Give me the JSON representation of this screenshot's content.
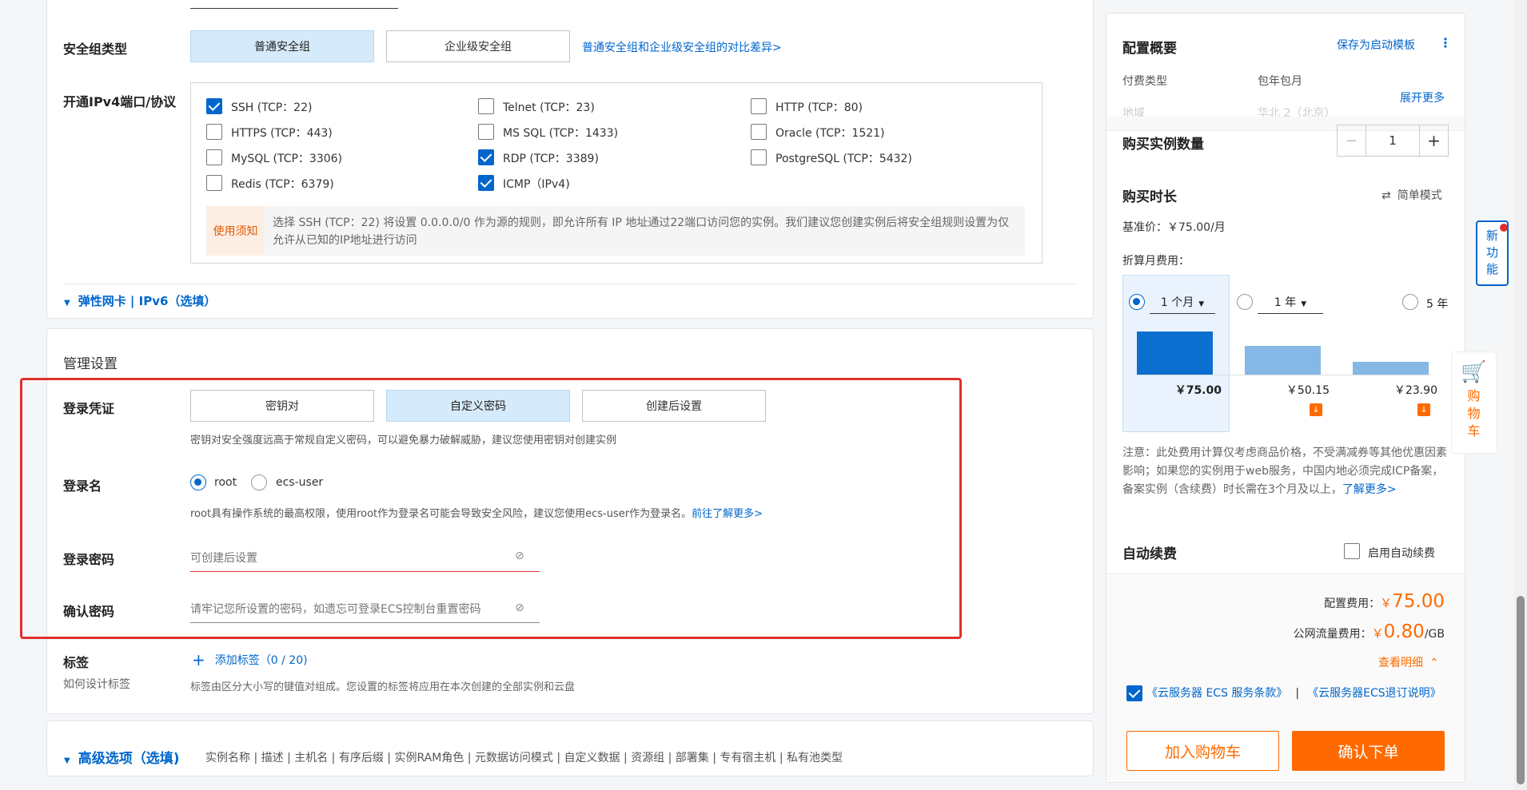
{
  "security_group": {
    "label": "安全组类型",
    "options": [
      "普通安全组",
      "企业级安全组"
    ],
    "compare_link": "普通安全组和企业级安全组的对比差异>"
  },
  "ports": {
    "label": "开通IPv4端口/协议",
    "items": [
      {
        "text": "SSH (TCP：22)",
        "checked": true
      },
      {
        "text": "Telnet (TCP：23)",
        "checked": false
      },
      {
        "text": "HTTP (TCP：80)",
        "checked": false
      },
      {
        "text": "HTTPS (TCP：443)",
        "checked": false
      },
      {
        "text": "MS SQL (TCP：1433)",
        "checked": false
      },
      {
        "text": "Oracle (TCP：1521)",
        "checked": false
      },
      {
        "text": "MySQL (TCP：3306)",
        "checked": false
      },
      {
        "text": "RDP (TCP：3389)",
        "checked": true
      },
      {
        "text": "PostgreSQL (TCP：5432)",
        "checked": false
      },
      {
        "text": "Redis (TCP：6379)",
        "checked": false
      },
      {
        "text": "ICMP（IPv4)",
        "checked": true
      }
    ],
    "notice_tag": "使用须知",
    "notice_text": "选择 SSH (TCP：22) 将设置 0.0.0.0/0 作为源的规则，即允许所有 IP 地址通过22端口访问您的实例。我们建议您创建实例后将安全组规则设置为仅允许从已知的IP地址进行访问"
  },
  "eni": {
    "label": "弹性网卡 | IPv6（选填）"
  },
  "mgmt": {
    "title": "管理设置",
    "credential": {
      "label": "登录凭证",
      "options": [
        "密钥对",
        "自定义密码",
        "创建后设置"
      ],
      "selected": 1,
      "hint": "密钥对安全强度远高于常规自定义密码，可以避免暴力破解威胁，建议您使用密钥对创建实例"
    },
    "login_name": {
      "label": "登录名",
      "options": [
        "root",
        "ecs-user"
      ],
      "hint": "root具有操作系统的最高权限，使用root作为登录名可能会导致安全风险，建议您使用ecs-user作为登录名。",
      "hint_link": "前往了解更多>"
    },
    "password": {
      "label": "登录密码",
      "placeholder": "可创建后设置"
    },
    "confirm": {
      "label": "确认密码",
      "placeholder": "请牢记您所设置的密码，如遗忘可登录ECS控制台重置密码"
    },
    "tags": {
      "label": "标签",
      "sub": "如何设计标签",
      "add": "添加标签（0 / 20)",
      "hint": "标签由区分大小写的键值对组成。您设置的标签将应用在本次创建的全部实例和云盘"
    }
  },
  "advanced": {
    "label": "高级选项（选填)",
    "items": "实例名称 | 描述 | 主机名 | 有序后缀 | 实例RAM角色 | 元数据访问模式 | 自定义数据 | 资源组 | 部署集 | 专有宿主机 | 私有池类型"
  },
  "summary": {
    "title": "配置概要",
    "save_template": "保存为启动模板",
    "pay_type_label": "付费类型",
    "pay_type_value": "包年包月",
    "region_label": "地域",
    "region_value": "华北 2（北京）",
    "expand": "展开更多",
    "quantity_label": "购买实例数量",
    "quantity": "1",
    "duration_label": "购买时长",
    "simple_mode": "简单模式",
    "base_price": "基准价：￥75.00/月",
    "discount_label": "折算月费用：",
    "options": [
      {
        "label": "1 个月",
        "price": "￥75.00",
        "selected": true,
        "discount": false,
        "level": 0.56
      },
      {
        "label": "1 年",
        "price": "￥50.15",
        "selected": false,
        "discount": true,
        "level": 0.37
      },
      {
        "label": "5 年",
        "price": "￥23.90",
        "selected": false,
        "discount": true,
        "level": 0.17
      }
    ],
    "note": "注意：此处费用计算仅考虑商品价格，不受满减券等其他优惠因素影响；如果您的实例用于web服务，中国内地必须完成ICP备案，备案实例（含续费）时长需在3个月及以上，",
    "note_link": "了解更多>",
    "auto_renew_label": "自动续费",
    "auto_renew_option": "启用自动续费",
    "config_fee_label": "配置费用：",
    "config_fee_value": "75.00",
    "currency": "￥",
    "traffic_fee_label": "公网流量费用：",
    "traffic_fee_value": "0.80",
    "traffic_unit": "/GB",
    "detail": "查看明细",
    "terms1": "《云服务器 ECS 服务条款》",
    "terms2": "《云服务器ECS退订说明》",
    "add_cart": "加入购物车",
    "confirm_order": "确认下单"
  },
  "float": {
    "new_feature": "新功能",
    "cart": "购物车"
  },
  "colors": {
    "accent": "#0066cc",
    "orange": "#ff6a00",
    "highlight_border": "#e0302c"
  }
}
